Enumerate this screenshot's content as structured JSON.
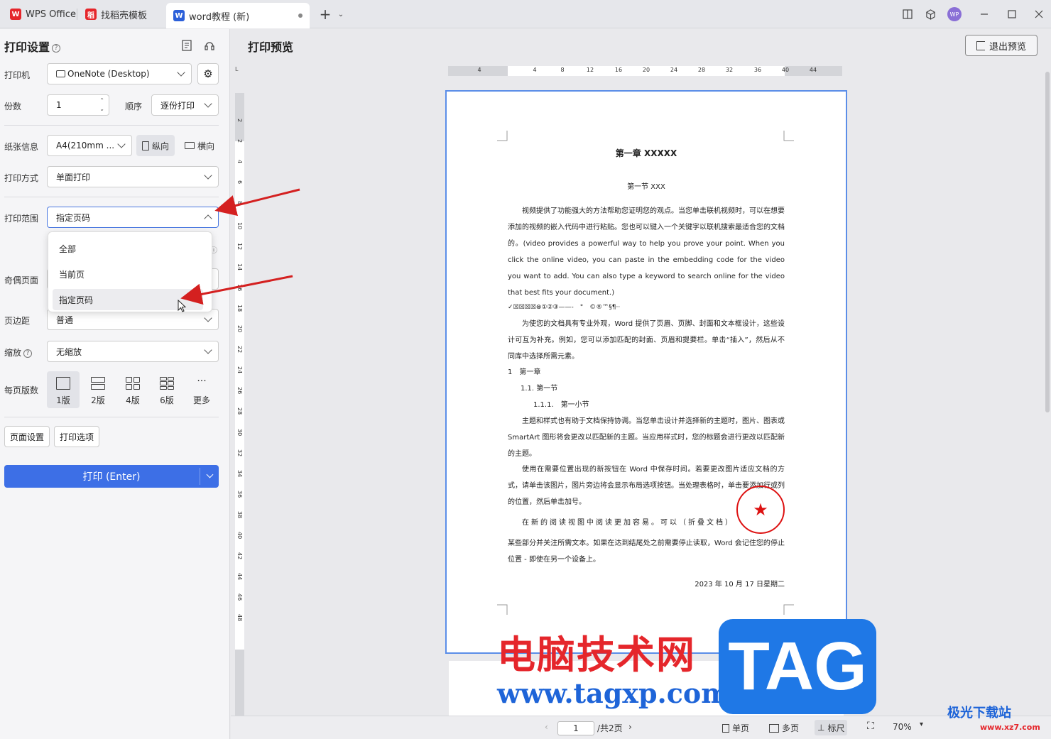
{
  "tabs": [
    {
      "label": "WPS Office",
      "icon": "wps-logo-icon",
      "color": "#e5262b"
    },
    {
      "label": "找稻壳模板",
      "icon": "docer-logo-icon",
      "color": "#e5262b"
    },
    {
      "label": "word教程 (新)",
      "icon": "word-doc-icon",
      "color": "#2b5fd9"
    }
  ],
  "avatar": "WP",
  "left": {
    "title": "打印设置",
    "printer_label": "打印机",
    "printer_value": "OneNote (Desktop)",
    "copies_label": "份数",
    "copies_value": "1",
    "order_label": "顺序",
    "order_value": "逐份打印",
    "paper_label": "纸张信息",
    "paper_value": "A4(210mm ...",
    "portrait_label": "纵向",
    "landscape_label": "横向",
    "mode_label": "打印方式",
    "mode_value": "单面打印",
    "range_label": "打印范围",
    "range_value": "指定页码",
    "odd_even_label": "奇偶页面",
    "margin_label": "页边距",
    "margin_value": "普通",
    "zoom_label": "缩放",
    "zoom_value": "无缩放",
    "per_page_label": "每页版数",
    "layouts": [
      "1版",
      "2版",
      "4版",
      "6版",
      "更多"
    ],
    "page_setup_btn": "页面设置",
    "print_options_btn": "打印选项",
    "print_btn": "打印 (Enter)"
  },
  "dropdown": {
    "items": [
      "全部",
      "当前页",
      "指定页码"
    ],
    "selected": "指定页码"
  },
  "main": {
    "title": "打印预览",
    "exit_btn": "退出预览",
    "h_ticks": [
      "4",
      "4",
      "8",
      "12",
      "16",
      "20",
      "24",
      "28",
      "32",
      "36",
      "40",
      "44"
    ],
    "v_ticks": [
      "2",
      "2",
      "4",
      "6",
      "8",
      "10",
      "12",
      "14",
      "16",
      "18",
      "20",
      "22",
      "24",
      "26",
      "28",
      "30",
      "32",
      "34",
      "36",
      "38",
      "40",
      "42",
      "44",
      "46",
      "48"
    ],
    "ruler_corner": "L"
  },
  "doc": {
    "chapter": "第一章  XXXXX",
    "section": "第一节  XXX",
    "para1": "视频提供了功能强大的方法帮助您证明您的观点。当您单击联机视频时，可以在想要添加的视频的嵌入代码中进行粘贴。您也可以键入一个关键字以联机搜索最适合您的文档的。(video provides a powerful way to help you prove your point. When you click the online video, you can paste in the embedding code for the video you want to add. You can also type a keyword to search online for the video that best fits your document.)",
    "symbols": "✓☒☒☒☒⊗①②③——-　°　©®™§¶··",
    "para2": "为使您的文档具有专业外观，Word 提供了页眉、页脚、封面和文本框设计，这些设计可互为补充。例如，您可以添加匹配的封面、页眉和提要栏。单击“插入”，然后从不同库中选择所需元素。",
    "list1": "1　第一章",
    "list2": "1.1.  第一节",
    "list3": "1.1.1.　第一小节",
    "para3": "主题和样式也有助于文档保持协调。当您单击设计并选择新的主题时，图片、图表或 SmartArt 图形将会更改以匹配新的主题。当应用样式时，您的标题会进行更改以匹配新的主题。",
    "para4": "使用在需要位置出现的新按钮在 Word 中保存时间。若要更改图片适应文档的方式，请单击该图片，图片旁边将会显示布局选项按钮。当处理表格时，单击要添加行或列的位置，然后单击加号。",
    "para5a": "在新的阅读视图中阅读更加容易。可以（折叠文档）",
    "para5b": "某些部分并关注所需文本。如果在达到结尾处之前需要停止读取，Word 会记住您的停止位置 - 即使在另一个设备上。",
    "date": "2023 年 10 月 17 日星期二"
  },
  "status": {
    "page_input": "1",
    "total": "/共2页",
    "single": "单页",
    "multi": "多页",
    "ruler": "标尺",
    "zoom": "70%"
  },
  "watermark": {
    "cn": "电脑技术网",
    "url": "www.tagxp.com",
    "tag": "TAG",
    "site": "极光下载站",
    "site_url": "www.xz7.com"
  },
  "colors": {
    "accent": "#3d6fe6",
    "arrow": "#d42020"
  }
}
